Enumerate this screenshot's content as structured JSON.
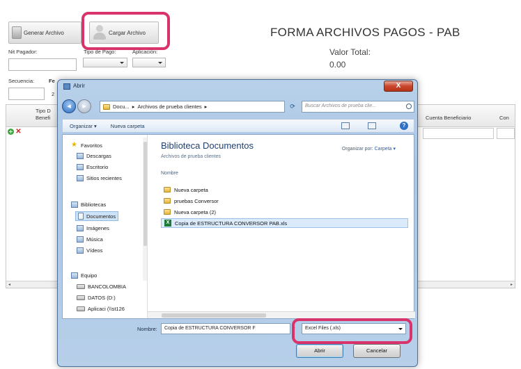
{
  "toolbar": {
    "generate_label": "Generar Archivo",
    "upload_label": "Cargar Archivo"
  },
  "form": {
    "title": "FORMA ARCHIVOS PAGOS - PAB",
    "valor_total_label": "Valor Total:",
    "valor_total_value": "0.00",
    "nit_pagador_label": "Nit Pagador:",
    "tipo_pago_label": "Tipo de Pago:",
    "aplicacion_label": "Aplicación:",
    "secuencia_label": "Secuencia:",
    "secuencia_prefix": "Fe",
    "secuencia_value": "2"
  },
  "grid": {
    "col_tipo_line1": "Tipo D",
    "col_tipo_line2": "Benefi",
    "col_cuenta": "Cuenta Beneficiario",
    "col_extra": "Con"
  },
  "dialog": {
    "title": "Abrir",
    "close_label": "X",
    "address": {
      "part1": "Docu...",
      "sep": "▸",
      "part2": "Archivos de prueba clientes",
      "arrow": "▸"
    },
    "search_placeholder": "Buscar Archivos de prueba clie...",
    "commands": {
      "organize": "Organizar ▾",
      "new_folder": "Nueva carpeta"
    },
    "nav": {
      "favoritos": "Favoritos",
      "descargas": "Descargas",
      "escritorio": "Escritorio",
      "sitios": "Sitios recientes",
      "bibliotecas": "Bibliotecas",
      "documentos": "Documentos",
      "imagenes": "Imágenes",
      "musica": "Música",
      "videos": "Vídeos",
      "equipo": "Equipo",
      "bancolombia": "BANCOLOMBIA",
      "datos": "DATOS (D:)",
      "aplicaci": "Aplicaci (\\\\st126"
    },
    "library": {
      "title": "Biblioteca Documentos",
      "subtitle": "Archivos de prueba clientes",
      "arrange_label": "Organizar por:",
      "arrange_value": "Carpeta ▾",
      "column_name": "Nombre"
    },
    "files": [
      "Nueva carpeta",
      "pruebas Conversor",
      "Nueva carpeta (2)",
      "Copia de ESTRUCTURA CONVERSOR PAB.xls"
    ],
    "filename_label": "Nombre:",
    "filename_value": "Copia de ESTRUCTURA CONVERSOR F",
    "filter_value": "Excel Files (.xls)",
    "open_label": "Abrir",
    "cancel_label": "Cancelar"
  },
  "colors": {
    "highlight": "#d8336a",
    "dialog_frame": "#a9c6e6",
    "link": "#2864b8"
  }
}
